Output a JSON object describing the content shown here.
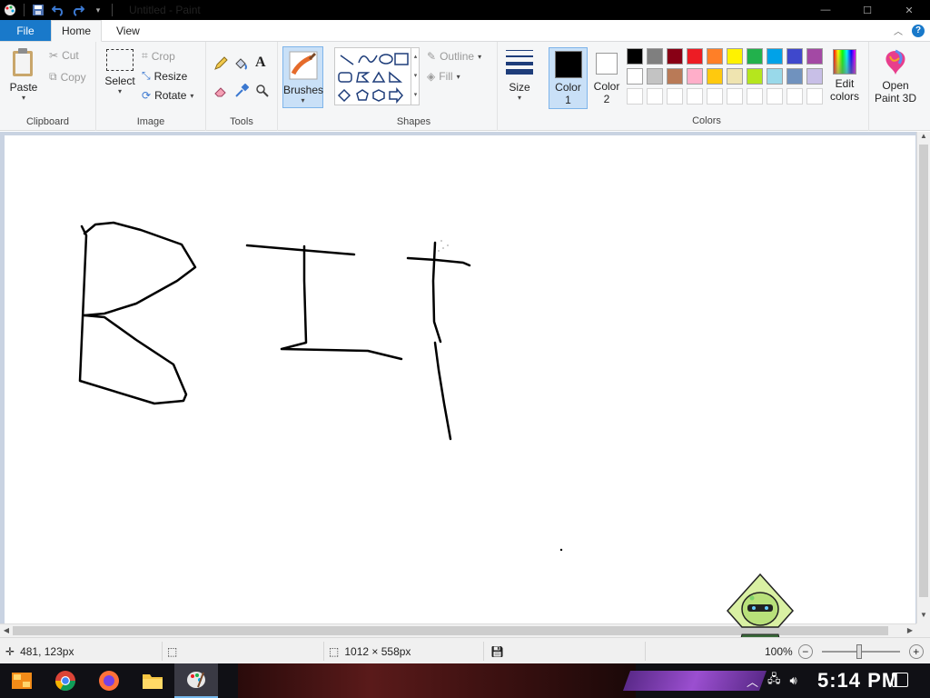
{
  "window": {
    "title": "Untitled - Paint",
    "controls": [
      "minimize",
      "maximize",
      "close"
    ]
  },
  "tabs": [
    {
      "label": "File"
    },
    {
      "label": "Home"
    },
    {
      "label": "View"
    }
  ],
  "ribbon": {
    "clipboard": {
      "label": "Clipboard",
      "paste": "Paste",
      "cut": "Cut",
      "copy": "Copy"
    },
    "image": {
      "label": "Image",
      "select": "Select",
      "crop": "Crop",
      "resize": "Resize",
      "rotate": "Rotate"
    },
    "tools": {
      "label": "Tools",
      "icons": [
        "pencil-icon",
        "fill-bucket-icon",
        "text-icon",
        "eraser-icon",
        "color-picker-icon",
        "magnifier-icon"
      ]
    },
    "brushes": {
      "label": "Brushes"
    },
    "shapes": {
      "label": "Shapes",
      "outline": "Outline",
      "fill": "Fill"
    },
    "size": {
      "label": "Size"
    },
    "colors": {
      "label": "Colors",
      "color1": {
        "label1": "Color",
        "label2": "1",
        "value": "#000000"
      },
      "color2": {
        "label1": "Color",
        "label2": "2",
        "value": "#ffffff"
      },
      "palette_row1": [
        "#000000",
        "#7f7f7f",
        "#880015",
        "#ed1c24",
        "#ff7f27",
        "#fff200",
        "#22b14c",
        "#00a2e8",
        "#3f48cc",
        "#a349a4"
      ],
      "palette_row2": [
        "#ffffff",
        "#c3c3c3",
        "#b97a57",
        "#ffaec9",
        "#ffc90e",
        "#efe4b0",
        "#b5e61d",
        "#99d9ea",
        "#7092be",
        "#c8bfe7"
      ],
      "edit_colors_line1": "Edit",
      "edit_colors_line2": "colors",
      "open_3d_line1": "Open",
      "open_3d_line2": "Paint 3D"
    }
  },
  "canvas": {
    "drawing_text": "BIT",
    "stroke_color": "#000000"
  },
  "statusbar": {
    "cursor_pos": "481, 123px",
    "image_size": "1012 × 558px",
    "zoom": "100%"
  },
  "taskbar": {
    "clock": "5:14 PM",
    "apps": [
      "start-icon",
      "chrome-icon",
      "firefox-icon",
      "file-explorer-icon",
      "paint-icon"
    ]
  }
}
